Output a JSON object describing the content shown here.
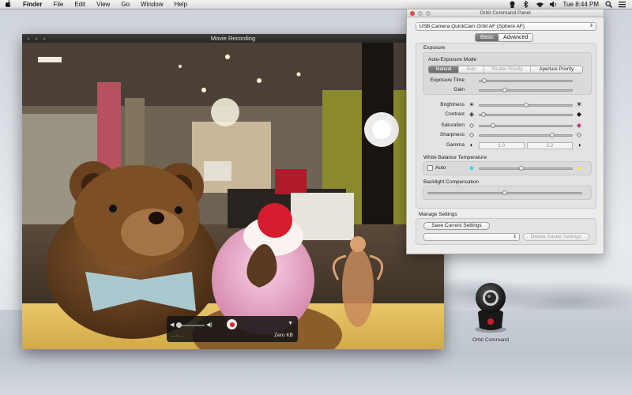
{
  "menubar": {
    "apple": "",
    "app_name": "Finder",
    "items": [
      "File",
      "Edit",
      "View",
      "Go",
      "Window",
      "Help"
    ],
    "clock": "Tue 8:44 PM"
  },
  "movie_window": {
    "title": "Movie Recording",
    "hud": {
      "elapsed": "--:--",
      "size": "Zero KB"
    }
  },
  "orbit_panel": {
    "title": "Orbit Command Panel",
    "camera_select": "USB Camera QuickCam Orbit AF (Sphere AF)",
    "tabs": [
      "Basic",
      "Advanced"
    ],
    "active_tab": "Basic",
    "exposure": {
      "section_label": "Exposure",
      "mode_label": "Auto-Exposure Mode",
      "modes": [
        "Manual",
        "Auto",
        "Shutter Priority",
        "Aperture Priority"
      ],
      "active_mode": "Manual",
      "exposure_time_label": "Exposure Time",
      "exposure_time_level": 0.06,
      "gain_label": "Gain",
      "gain_level": 0.28
    },
    "image": {
      "brightness_label": "Brightness",
      "brightness_level": 0.5,
      "contrast_label": "Contrast",
      "contrast_level": 0.05,
      "saturation_label": "Saturation",
      "saturation_level": 0.15,
      "sharpness_label": "Sharpness",
      "sharpness_level": 0.78,
      "gamma_label": "Gamma",
      "gamma_min": "1.0",
      "gamma_max": "2.2"
    },
    "white_balance": {
      "section_label": "White Balance Temperature",
      "auto_label": "Auto",
      "level": 0.45
    },
    "backlight": {
      "section_label": "Backlight Compensation",
      "level": 0.5
    },
    "manage": {
      "section_label": "Manage Settings",
      "save_button": "Save Current Settings",
      "saved_select": "",
      "delete_button": "Delete Saved Settings"
    }
  },
  "desktop_icon": {
    "label": "Orbit Command"
  },
  "colors": {
    "record_red": "#e0202a",
    "close_red": "#e14a3f",
    "wb_cool": "#3fd6e0",
    "wb_warm": "#f2ea62"
  }
}
